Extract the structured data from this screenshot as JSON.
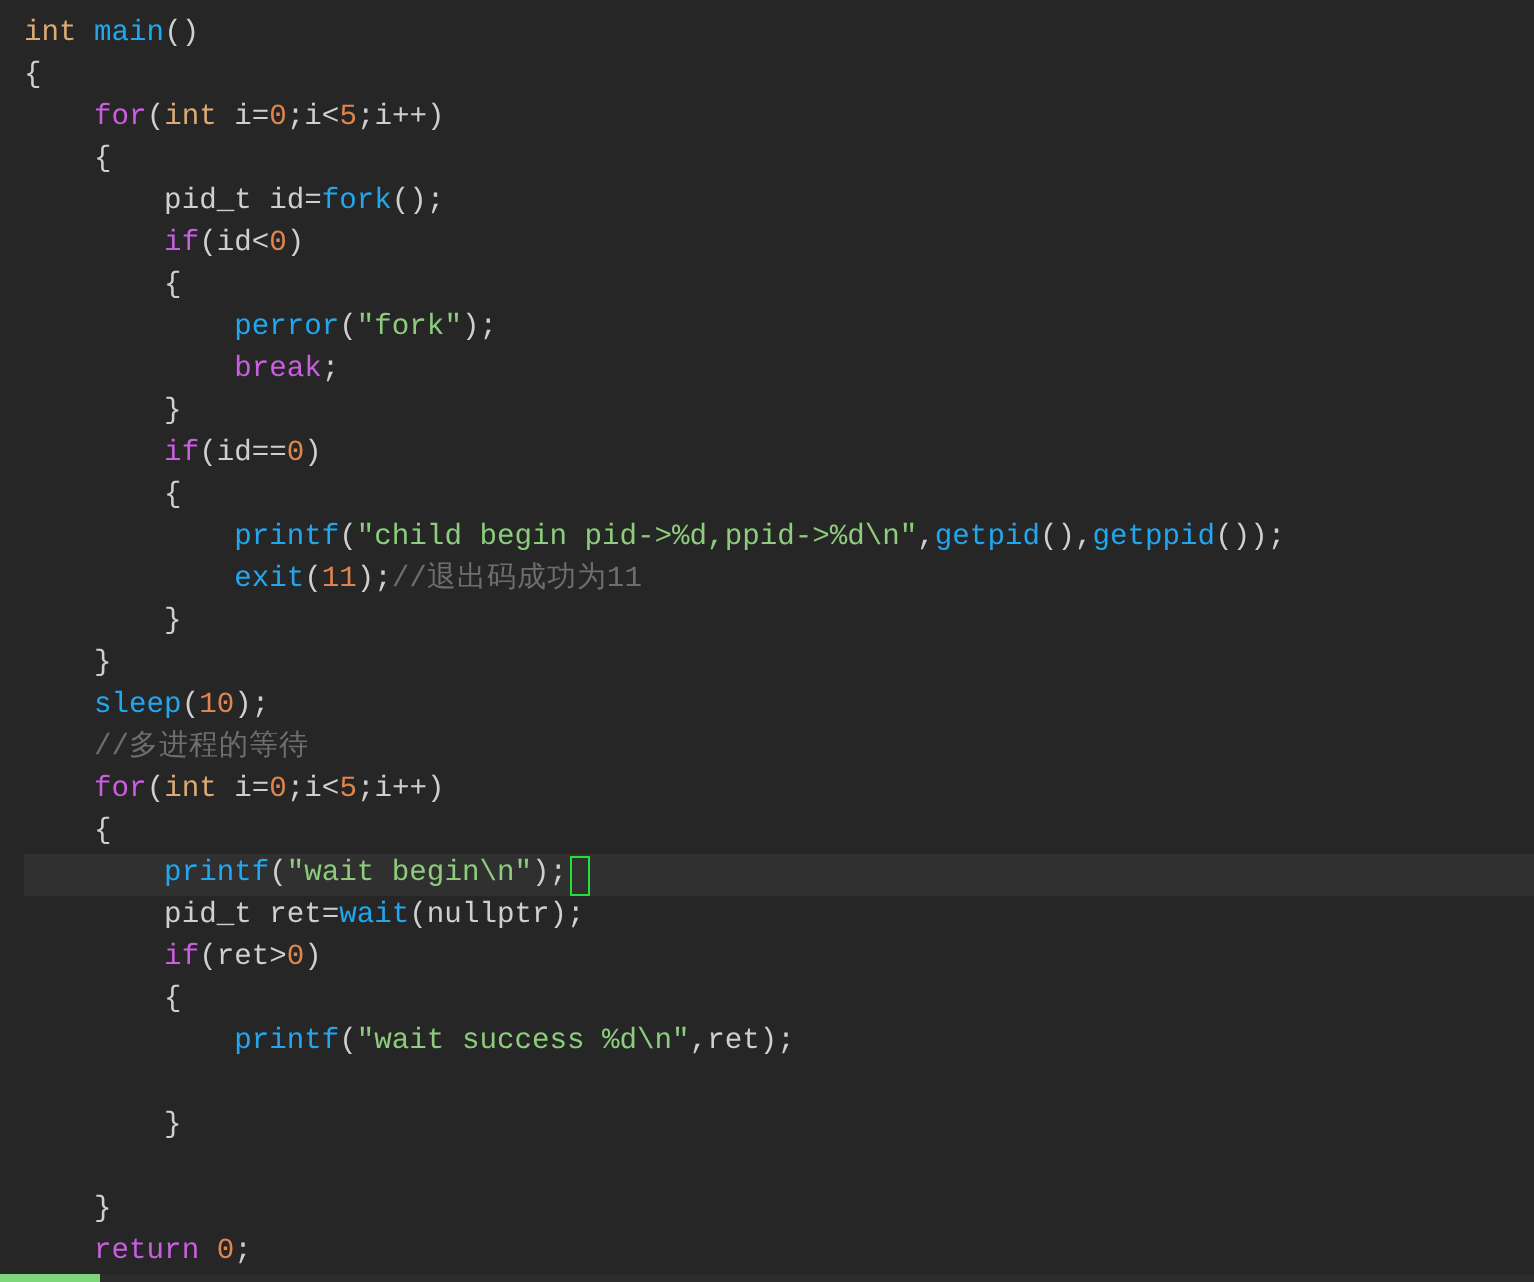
{
  "editor": {
    "lines": [
      {
        "current": false,
        "tokens": [
          {
            "kind": "type",
            "text": "int "
          },
          {
            "kind": "func",
            "text": "main"
          },
          {
            "kind": "plain",
            "text": "()"
          }
        ]
      },
      {
        "current": false,
        "tokens": [
          {
            "kind": "plain",
            "text": "{"
          }
        ]
      },
      {
        "current": false,
        "tokens": [
          {
            "kind": "keyword",
            "text": "    for"
          },
          {
            "kind": "plain",
            "text": "("
          },
          {
            "kind": "type",
            "text": "int"
          },
          {
            "kind": "plain",
            "text": " i="
          },
          {
            "kind": "number",
            "text": "0"
          },
          {
            "kind": "plain",
            "text": ";i<"
          },
          {
            "kind": "number",
            "text": "5"
          },
          {
            "kind": "plain",
            "text": ";i++)"
          }
        ]
      },
      {
        "current": false,
        "tokens": [
          {
            "kind": "plain",
            "text": "    {"
          }
        ]
      },
      {
        "current": false,
        "tokens": [
          {
            "kind": "plain",
            "text": "        pid_t id="
          },
          {
            "kind": "func",
            "text": "fork"
          },
          {
            "kind": "plain",
            "text": "();"
          }
        ]
      },
      {
        "current": false,
        "tokens": [
          {
            "kind": "keyword",
            "text": "        if"
          },
          {
            "kind": "plain",
            "text": "(id<"
          },
          {
            "kind": "number",
            "text": "0"
          },
          {
            "kind": "plain",
            "text": ")"
          }
        ]
      },
      {
        "current": false,
        "tokens": [
          {
            "kind": "plain",
            "text": "        {"
          }
        ]
      },
      {
        "current": false,
        "tokens": [
          {
            "kind": "func",
            "text": "            perror"
          },
          {
            "kind": "plain",
            "text": "("
          },
          {
            "kind": "string",
            "text": "\"fork\""
          },
          {
            "kind": "plain",
            "text": ");"
          }
        ]
      },
      {
        "current": false,
        "tokens": [
          {
            "kind": "keyword",
            "text": "            break"
          },
          {
            "kind": "plain",
            "text": ";"
          }
        ]
      },
      {
        "current": false,
        "tokens": [
          {
            "kind": "plain",
            "text": "        }"
          }
        ]
      },
      {
        "current": false,
        "tokens": [
          {
            "kind": "keyword",
            "text": "        if"
          },
          {
            "kind": "plain",
            "text": "(id=="
          },
          {
            "kind": "number",
            "text": "0"
          },
          {
            "kind": "plain",
            "text": ")"
          }
        ]
      },
      {
        "current": false,
        "tokens": [
          {
            "kind": "plain",
            "text": "        {"
          }
        ]
      },
      {
        "current": false,
        "tokens": [
          {
            "kind": "func",
            "text": "            printf"
          },
          {
            "kind": "plain",
            "text": "("
          },
          {
            "kind": "string",
            "text": "\"child begin pid->%d,ppid->%d\\n\""
          },
          {
            "kind": "plain",
            "text": ","
          },
          {
            "kind": "func",
            "text": "getpid"
          },
          {
            "kind": "plain",
            "text": "(),"
          },
          {
            "kind": "func",
            "text": "getppid"
          },
          {
            "kind": "plain",
            "text": "());"
          }
        ]
      },
      {
        "current": false,
        "tokens": [
          {
            "kind": "func",
            "text": "            exit"
          },
          {
            "kind": "plain",
            "text": "("
          },
          {
            "kind": "number",
            "text": "11"
          },
          {
            "kind": "plain",
            "text": ");"
          },
          {
            "kind": "comment",
            "text": "//退出码成功为11"
          }
        ]
      },
      {
        "current": false,
        "tokens": [
          {
            "kind": "plain",
            "text": "        }"
          }
        ]
      },
      {
        "current": false,
        "tokens": [
          {
            "kind": "plain",
            "text": "    }"
          }
        ]
      },
      {
        "current": false,
        "tokens": [
          {
            "kind": "func",
            "text": "    sleep"
          },
          {
            "kind": "plain",
            "text": "("
          },
          {
            "kind": "number",
            "text": "10"
          },
          {
            "kind": "plain",
            "text": ");"
          }
        ]
      },
      {
        "current": false,
        "tokens": [
          {
            "kind": "comment",
            "text": "    //多进程的等待"
          }
        ]
      },
      {
        "current": false,
        "tokens": [
          {
            "kind": "keyword",
            "text": "    for"
          },
          {
            "kind": "plain",
            "text": "("
          },
          {
            "kind": "type",
            "text": "int"
          },
          {
            "kind": "plain",
            "text": " i="
          },
          {
            "kind": "number",
            "text": "0"
          },
          {
            "kind": "plain",
            "text": ";i<"
          },
          {
            "kind": "number",
            "text": "5"
          },
          {
            "kind": "plain",
            "text": ";i++)"
          }
        ]
      },
      {
        "current": false,
        "tokens": [
          {
            "kind": "plain",
            "text": "    {"
          }
        ]
      },
      {
        "current": true,
        "tokens": [
          {
            "kind": "func",
            "text": "        printf"
          },
          {
            "kind": "plain",
            "text": "("
          },
          {
            "kind": "string",
            "text": "\"wait begin\\n\""
          },
          {
            "kind": "plain",
            "text": ");"
          }
        ]
      },
      {
        "current": false,
        "tokens": [
          {
            "kind": "plain",
            "text": "        pid_t ret="
          },
          {
            "kind": "func",
            "text": "wait"
          },
          {
            "kind": "plain",
            "text": "(nullptr);"
          }
        ]
      },
      {
        "current": false,
        "tokens": [
          {
            "kind": "keyword",
            "text": "        if"
          },
          {
            "kind": "plain",
            "text": "(ret>"
          },
          {
            "kind": "number",
            "text": "0"
          },
          {
            "kind": "plain",
            "text": ")"
          }
        ]
      },
      {
        "current": false,
        "tokens": [
          {
            "kind": "plain",
            "text": "        {"
          }
        ]
      },
      {
        "current": false,
        "tokens": [
          {
            "kind": "func",
            "text": "            printf"
          },
          {
            "kind": "plain",
            "text": "("
          },
          {
            "kind": "string",
            "text": "\"wait success %d\\n\""
          },
          {
            "kind": "plain",
            "text": ",ret);"
          }
        ]
      },
      {
        "current": false
      },
      {
        "current": false,
        "tokens": [
          {
            "kind": "plain",
            "text": "        }"
          }
        ]
      },
      {
        "current": false
      },
      {
        "current": false,
        "tokens": [
          {
            "kind": "plain",
            "text": "    }"
          }
        ]
      },
      {
        "current": false,
        "tokens": [
          {
            "kind": "keyword",
            "text": "    return "
          },
          {
            "kind": "number",
            "text": "0"
          },
          {
            "kind": "plain",
            "text": ";"
          }
        ]
      }
    ]
  }
}
